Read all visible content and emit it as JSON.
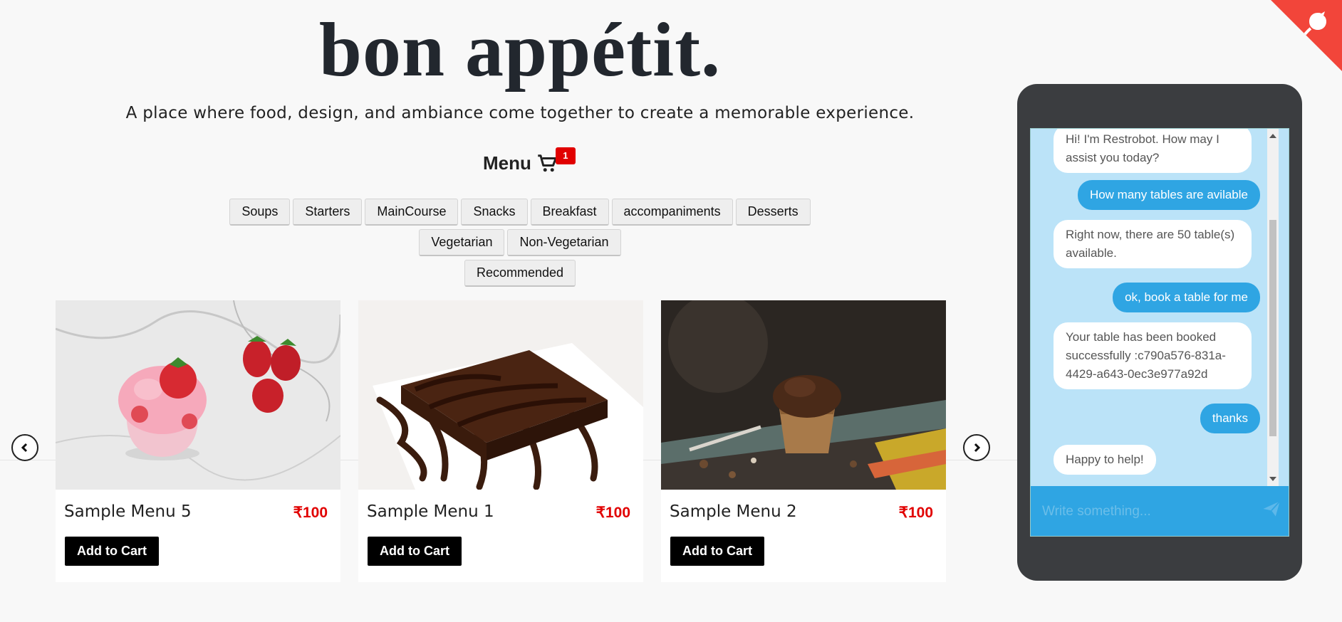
{
  "header": {
    "title": "bon appétit.",
    "subtitle": "A place where food, design, and ambiance come together to create a memorable experience."
  },
  "menu": {
    "label": "Menu",
    "cart_count": "1"
  },
  "filters": {
    "row1": [
      "Soups",
      "Starters",
      "MainCourse",
      "Snacks",
      "Breakfast",
      "accompaniments",
      "Desserts"
    ],
    "row2": [
      "Vegetarian",
      "Non-Vegetarian"
    ],
    "row3": [
      "Recommended"
    ]
  },
  "cards": [
    {
      "name": "Sample Menu 5",
      "price": "₹100",
      "button": "Add to Cart",
      "image": "strawberry-icecream"
    },
    {
      "name": "Sample Menu 1",
      "price": "₹100",
      "button": "Add to Cart",
      "image": "chocolate-brownie"
    },
    {
      "name": "Sample Menu 2",
      "price": "₹100",
      "button": "Add to Cart",
      "image": "chocolate-muffin"
    }
  ],
  "chat": {
    "messages": [
      {
        "from": "bot",
        "text": "Hi! I'm Restrobot. How may I assist you today?"
      },
      {
        "from": "user",
        "text": "How many tables are avilable"
      },
      {
        "from": "bot",
        "text": "Right now, there are 50 table(s) available."
      },
      {
        "from": "user",
        "text": "ok, book a table for me"
      },
      {
        "from": "bot",
        "text": "Your table has been booked successfully :c790a576-831a-4429-a643-0ec3e977a92d"
      },
      {
        "from": "user",
        "text": "thanks"
      },
      {
        "from": "bot",
        "text": "Happy to help!"
      }
    ],
    "input_placeholder": "Write something..."
  },
  "colors": {
    "accent": "#2fa5e3",
    "price": "#e10000",
    "corner": "#f2453a",
    "phone": "#3b3d40",
    "chat_bg": "#bbe3f8"
  },
  "icons": {
    "cart": "cart-icon",
    "prev": "chevron-left-icon",
    "next": "chevron-right-icon",
    "send": "send-icon",
    "corner": "github-corner-icon"
  }
}
